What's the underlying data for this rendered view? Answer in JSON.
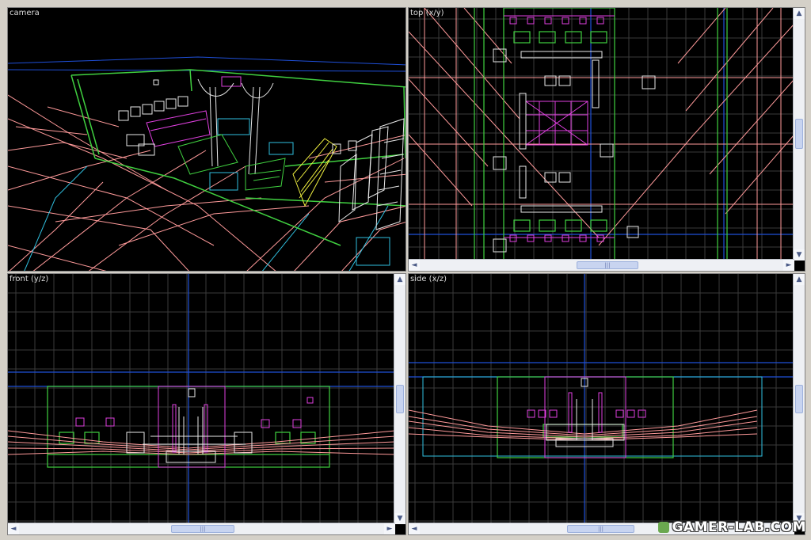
{
  "viewports": {
    "camera": {
      "label": "camera"
    },
    "top": {
      "label": "top (x/y)"
    },
    "front": {
      "label": "front (y/z)"
    },
    "side": {
      "label": "side (x/z)"
    }
  },
  "scroll": {
    "up": "▲",
    "down": "▼",
    "left": "◄",
    "right": "►",
    "grip": "|||"
  },
  "watermark": "GAMER-LAB.COM",
  "colors": {
    "background": "#000000",
    "grid": "#3a3a3a",
    "axis_blue": "#1f4fd8",
    "brush_pink": "#ff9a9a",
    "brush_green": "#40d040",
    "entity_magenta": "#e040e0",
    "white": "#e8e8e8",
    "cyan": "#30c0e0",
    "yellow": "#f0f040"
  }
}
